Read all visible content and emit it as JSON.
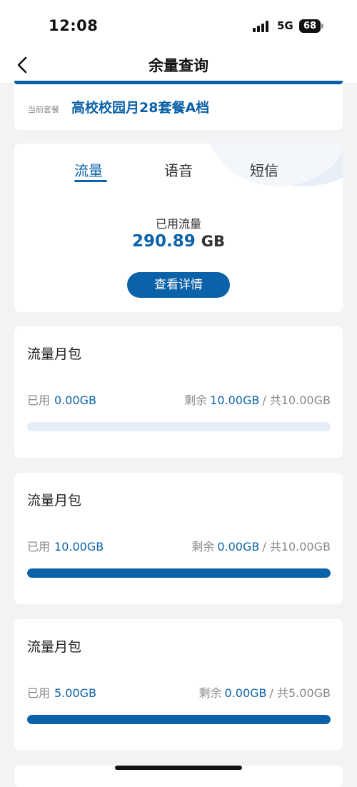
{
  "status": {
    "time": "12:08",
    "network": "5G",
    "battery": "68"
  },
  "nav": {
    "title": "余量查询"
  },
  "plan": {
    "label": "当前套餐",
    "name": "高校校园月28套餐A档"
  },
  "usage": {
    "tabs": [
      {
        "label": "流量",
        "active": true
      },
      {
        "label": "语音",
        "active": false
      },
      {
        "label": "短信",
        "active": false
      }
    ],
    "used_label": "已用流量",
    "used_value": "290.89",
    "used_unit": "GB",
    "detail_button": "查看详情"
  },
  "packs": [
    {
      "title": "流量月包",
      "used_label": "已用",
      "used": "0.00GB",
      "remain_label": "剩余",
      "remain": "10.00GB",
      "total": "/ 共10.00GB",
      "progress": 0.0
    },
    {
      "title": "流量月包",
      "used_label": "已用",
      "used": "10.00GB",
      "remain_label": "剩余",
      "remain": "0.00GB",
      "total": "/ 共10.00GB",
      "progress": 1.0
    },
    {
      "title": "流量月包",
      "used_label": "已用",
      "used": "5.00GB",
      "remain_label": "剩余",
      "remain": "0.00GB",
      "total": "/ 共5.00GB",
      "progress": 1.0
    }
  ],
  "colors": {
    "accent": "#0b62a8",
    "track": "#e6edf9",
    "background": "#f2f3f5"
  }
}
